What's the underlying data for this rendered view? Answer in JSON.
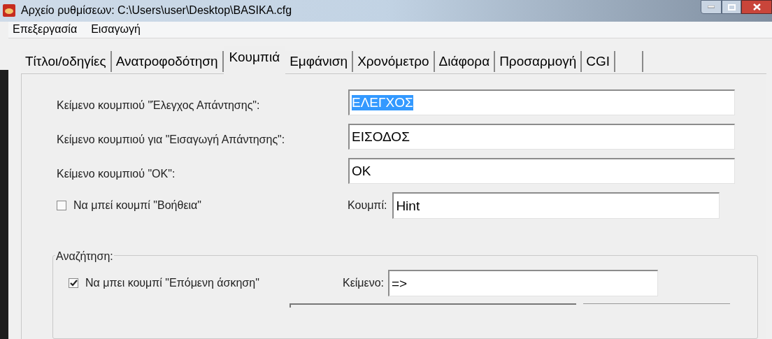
{
  "window": {
    "title": "Αρχείο ρυθμίσεων:  C:\\Users\\user\\Desktop\\BASIKA.cfg"
  },
  "menu": [
    "Επεξεργασία",
    "Εισαγωγή"
  ],
  "tabs": [
    {
      "label": "Τίτλοι/οδηγίες",
      "selected": false
    },
    {
      "label": "Ανατροφοδότηση",
      "selected": false
    },
    {
      "label": "Κουμπιά",
      "selected": true
    },
    {
      "label": "Εμφάνιση",
      "selected": false
    },
    {
      "label": "Χρονόμετρο",
      "selected": false
    },
    {
      "label": "Διάφορα",
      "selected": false
    },
    {
      "label": "Προσαρμογή",
      "selected": false
    },
    {
      "label": "CGI",
      "selected": false
    }
  ],
  "fields": [
    {
      "label": "Κείμενο κουμπιού \"Έλεγχος Απάντησης\":",
      "value": "ΕΛΕΓΧΟΣ",
      "text_selected": true
    },
    {
      "label": "Κείμενο κουμπιού για \"Εισαγωγή Απάντησης\":",
      "value": "ΕΙΣΟΔΟΣ",
      "text_selected": false
    },
    {
      "label": "Κείμενο κουμπιού \"ΟΚ\":",
      "value": "OK",
      "text_selected": false
    }
  ],
  "help_button": {
    "label": "Να μπεί κουμπί \"Βοήθεια\"",
    "checked": false,
    "field_label": "Κουμπί:",
    "value": "Hint"
  },
  "search_group": {
    "title": "Αναζήτηση:",
    "label": "Να μπει κουμπί \"Επόμενη άσκηση\"",
    "checked": true,
    "field_label": "Κείμενο:",
    "value": "=>"
  }
}
